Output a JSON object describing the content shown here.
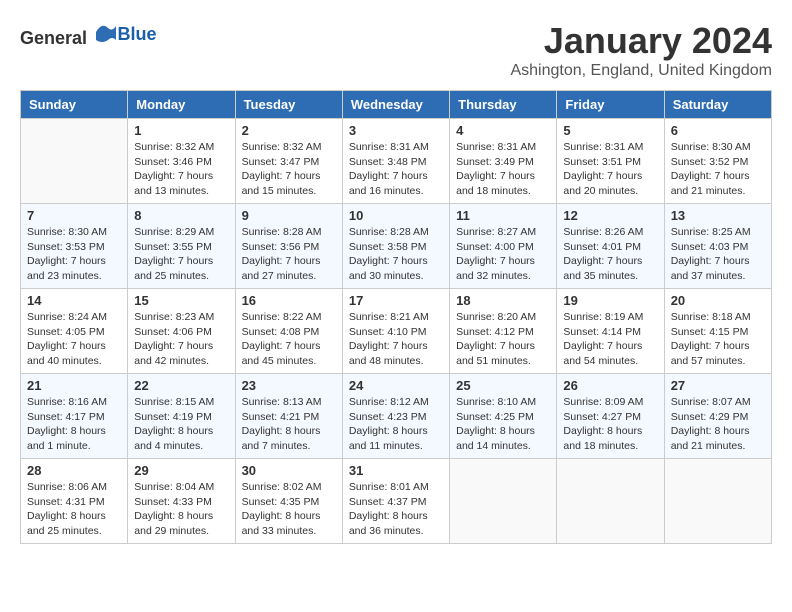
{
  "logo": {
    "text_general": "General",
    "text_blue": "Blue"
  },
  "title": "January 2024",
  "location": "Ashington, England, United Kingdom",
  "days_of_week": [
    "Sunday",
    "Monday",
    "Tuesday",
    "Wednesday",
    "Thursday",
    "Friday",
    "Saturday"
  ],
  "weeks": [
    [
      {
        "day": "",
        "empty": true
      },
      {
        "day": "1",
        "sunrise": "Sunrise: 8:32 AM",
        "sunset": "Sunset: 3:46 PM",
        "daylight": "Daylight: 7 hours and 13 minutes."
      },
      {
        "day": "2",
        "sunrise": "Sunrise: 8:32 AM",
        "sunset": "Sunset: 3:47 PM",
        "daylight": "Daylight: 7 hours and 15 minutes."
      },
      {
        "day": "3",
        "sunrise": "Sunrise: 8:31 AM",
        "sunset": "Sunset: 3:48 PM",
        "daylight": "Daylight: 7 hours and 16 minutes."
      },
      {
        "day": "4",
        "sunrise": "Sunrise: 8:31 AM",
        "sunset": "Sunset: 3:49 PM",
        "daylight": "Daylight: 7 hours and 18 minutes."
      },
      {
        "day": "5",
        "sunrise": "Sunrise: 8:31 AM",
        "sunset": "Sunset: 3:51 PM",
        "daylight": "Daylight: 7 hours and 20 minutes."
      },
      {
        "day": "6",
        "sunrise": "Sunrise: 8:30 AM",
        "sunset": "Sunset: 3:52 PM",
        "daylight": "Daylight: 7 hours and 21 minutes."
      }
    ],
    [
      {
        "day": "7",
        "sunrise": "Sunrise: 8:30 AM",
        "sunset": "Sunset: 3:53 PM",
        "daylight": "Daylight: 7 hours and 23 minutes."
      },
      {
        "day": "8",
        "sunrise": "Sunrise: 8:29 AM",
        "sunset": "Sunset: 3:55 PM",
        "daylight": "Daylight: 7 hours and 25 minutes."
      },
      {
        "day": "9",
        "sunrise": "Sunrise: 8:28 AM",
        "sunset": "Sunset: 3:56 PM",
        "daylight": "Daylight: 7 hours and 27 minutes."
      },
      {
        "day": "10",
        "sunrise": "Sunrise: 8:28 AM",
        "sunset": "Sunset: 3:58 PM",
        "daylight": "Daylight: 7 hours and 30 minutes."
      },
      {
        "day": "11",
        "sunrise": "Sunrise: 8:27 AM",
        "sunset": "Sunset: 4:00 PM",
        "daylight": "Daylight: 7 hours and 32 minutes."
      },
      {
        "day": "12",
        "sunrise": "Sunrise: 8:26 AM",
        "sunset": "Sunset: 4:01 PM",
        "daylight": "Daylight: 7 hours and 35 minutes."
      },
      {
        "day": "13",
        "sunrise": "Sunrise: 8:25 AM",
        "sunset": "Sunset: 4:03 PM",
        "daylight": "Daylight: 7 hours and 37 minutes."
      }
    ],
    [
      {
        "day": "14",
        "sunrise": "Sunrise: 8:24 AM",
        "sunset": "Sunset: 4:05 PM",
        "daylight": "Daylight: 7 hours and 40 minutes."
      },
      {
        "day": "15",
        "sunrise": "Sunrise: 8:23 AM",
        "sunset": "Sunset: 4:06 PM",
        "daylight": "Daylight: 7 hours and 42 minutes."
      },
      {
        "day": "16",
        "sunrise": "Sunrise: 8:22 AM",
        "sunset": "Sunset: 4:08 PM",
        "daylight": "Daylight: 7 hours and 45 minutes."
      },
      {
        "day": "17",
        "sunrise": "Sunrise: 8:21 AM",
        "sunset": "Sunset: 4:10 PM",
        "daylight": "Daylight: 7 hours and 48 minutes."
      },
      {
        "day": "18",
        "sunrise": "Sunrise: 8:20 AM",
        "sunset": "Sunset: 4:12 PM",
        "daylight": "Daylight: 7 hours and 51 minutes."
      },
      {
        "day": "19",
        "sunrise": "Sunrise: 8:19 AM",
        "sunset": "Sunset: 4:14 PM",
        "daylight": "Daylight: 7 hours and 54 minutes."
      },
      {
        "day": "20",
        "sunrise": "Sunrise: 8:18 AM",
        "sunset": "Sunset: 4:15 PM",
        "daylight": "Daylight: 7 hours and 57 minutes."
      }
    ],
    [
      {
        "day": "21",
        "sunrise": "Sunrise: 8:16 AM",
        "sunset": "Sunset: 4:17 PM",
        "daylight": "Daylight: 8 hours and 1 minute."
      },
      {
        "day": "22",
        "sunrise": "Sunrise: 8:15 AM",
        "sunset": "Sunset: 4:19 PM",
        "daylight": "Daylight: 8 hours and 4 minutes."
      },
      {
        "day": "23",
        "sunrise": "Sunrise: 8:13 AM",
        "sunset": "Sunset: 4:21 PM",
        "daylight": "Daylight: 8 hours and 7 minutes."
      },
      {
        "day": "24",
        "sunrise": "Sunrise: 8:12 AM",
        "sunset": "Sunset: 4:23 PM",
        "daylight": "Daylight: 8 hours and 11 minutes."
      },
      {
        "day": "25",
        "sunrise": "Sunrise: 8:10 AM",
        "sunset": "Sunset: 4:25 PM",
        "daylight": "Daylight: 8 hours and 14 minutes."
      },
      {
        "day": "26",
        "sunrise": "Sunrise: 8:09 AM",
        "sunset": "Sunset: 4:27 PM",
        "daylight": "Daylight: 8 hours and 18 minutes."
      },
      {
        "day": "27",
        "sunrise": "Sunrise: 8:07 AM",
        "sunset": "Sunset: 4:29 PM",
        "daylight": "Daylight: 8 hours and 21 minutes."
      }
    ],
    [
      {
        "day": "28",
        "sunrise": "Sunrise: 8:06 AM",
        "sunset": "Sunset: 4:31 PM",
        "daylight": "Daylight: 8 hours and 25 minutes."
      },
      {
        "day": "29",
        "sunrise": "Sunrise: 8:04 AM",
        "sunset": "Sunset: 4:33 PM",
        "daylight": "Daylight: 8 hours and 29 minutes."
      },
      {
        "day": "30",
        "sunrise": "Sunrise: 8:02 AM",
        "sunset": "Sunset: 4:35 PM",
        "daylight": "Daylight: 8 hours and 33 minutes."
      },
      {
        "day": "31",
        "sunrise": "Sunrise: 8:01 AM",
        "sunset": "Sunset: 4:37 PM",
        "daylight": "Daylight: 8 hours and 36 minutes."
      },
      {
        "day": "",
        "empty": true
      },
      {
        "day": "",
        "empty": true
      },
      {
        "day": "",
        "empty": true
      }
    ]
  ]
}
